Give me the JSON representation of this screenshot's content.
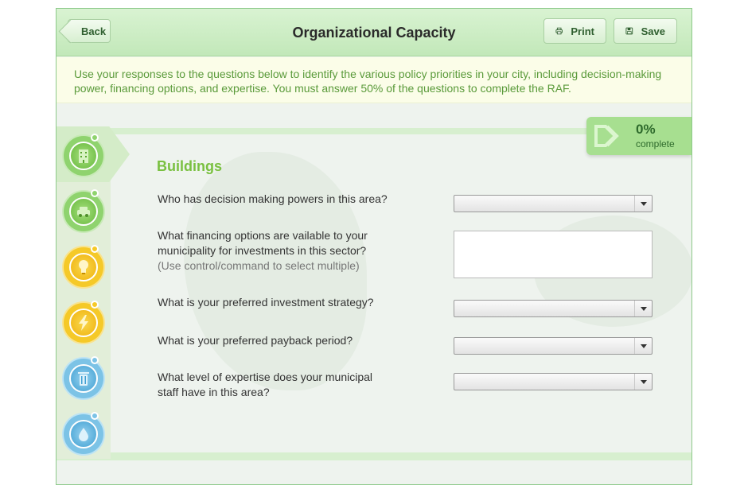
{
  "header": {
    "title": "Organizational Capacity",
    "back_label": "Back",
    "print_label": "Print",
    "save_label": "Save"
  },
  "intro": {
    "text": "Use your responses to the questions below to identify the various policy priorities in your city, including decision-making power, financing options, and expertise.  You must answer 50% of the questions to complete the RAF."
  },
  "progress": {
    "percent": "0%",
    "label": "complete"
  },
  "sidebar": {
    "items": [
      {
        "icon": "building-icon",
        "color": "#79c040",
        "active": true
      },
      {
        "icon": "car-icon",
        "color": "#79c040"
      },
      {
        "icon": "lightbulb-icon",
        "color": "#f0b10c"
      },
      {
        "icon": "lightning-icon",
        "color": "#f0b10c"
      },
      {
        "icon": "trash-bin-icon",
        "color": "#3f9fd2"
      },
      {
        "icon": "water-drop-icon",
        "color": "#3f9fd2"
      }
    ]
  },
  "section": {
    "title": "Buildings",
    "questions": [
      {
        "text": "Who has decision making powers in this area?",
        "control": "select",
        "value": ""
      },
      {
        "text": "What financing options are vailable to your municipality for investments in this sector?",
        "hint": "(Use control/command to select multiple)",
        "control": "multiselect",
        "value": ""
      },
      {
        "text": "What is your preferred investment strategy?",
        "control": "select",
        "value": ""
      },
      {
        "text": "What is your preferred payback period?",
        "control": "select",
        "value": ""
      },
      {
        "text": "What level of expertise does your municipal staff have in this area?",
        "control": "select",
        "value": ""
      }
    ]
  }
}
